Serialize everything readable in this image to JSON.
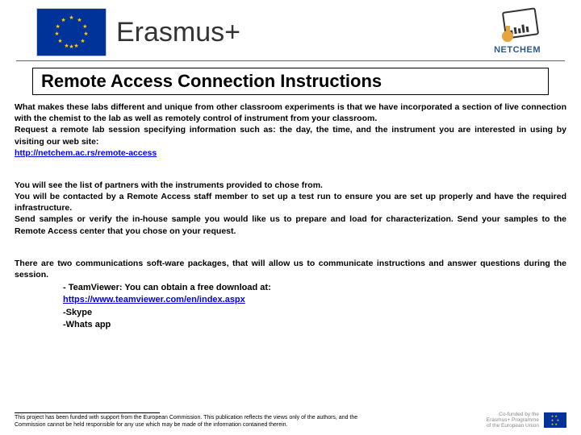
{
  "header": {
    "program": "Erasmus+",
    "brand": "NETCHEM"
  },
  "title": "Remote Access Connection Instructions",
  "intro": "What makes these labs different and unique from other classroom experiments is that we have incorporated a section of live connection with the chemist to the lab as well as remotely control of instrument from your classroom.",
  "request": "Request a remote lab session specifying information such as: the day, the time, and the instrument you are interested in using by visiting our web site:",
  "site_link": "http://netchem.ac.rs/remote-access",
  "steps": {
    "partners": "You will see the list of partners with the instruments provided to chose from.",
    "contact": "You will be contacted by a Remote Access staff member to set up a test run to ensure you are set up properly and have the required infrastructure.",
    "samples": "Send samples or verify the in-house sample you would like us to prepare and load for characterization. Send your samples to the Remote Access center that you chose on your request."
  },
  "software": {
    "intro": "There are two communications soft-ware packages, that will allow us to communicate instructions and answer questions during the session.",
    "tv_label": "- TeamViewer: You can obtain a free download at:",
    "tv_link": "https://www.teamviewer.com/en/index.aspx",
    "skype": "-Skype",
    "whatsapp": "-Whats app"
  },
  "footer": {
    "disclaimer": "This project has been funded with support from the European Commission. This publication reflects the views only of the authors, and the Commission cannot be held responsible for any use which may be made of the information contained therein.",
    "cofund1": "Co-funded by the",
    "cofund2": "Erasmus+ Programme",
    "cofund3": "of the European Union"
  }
}
